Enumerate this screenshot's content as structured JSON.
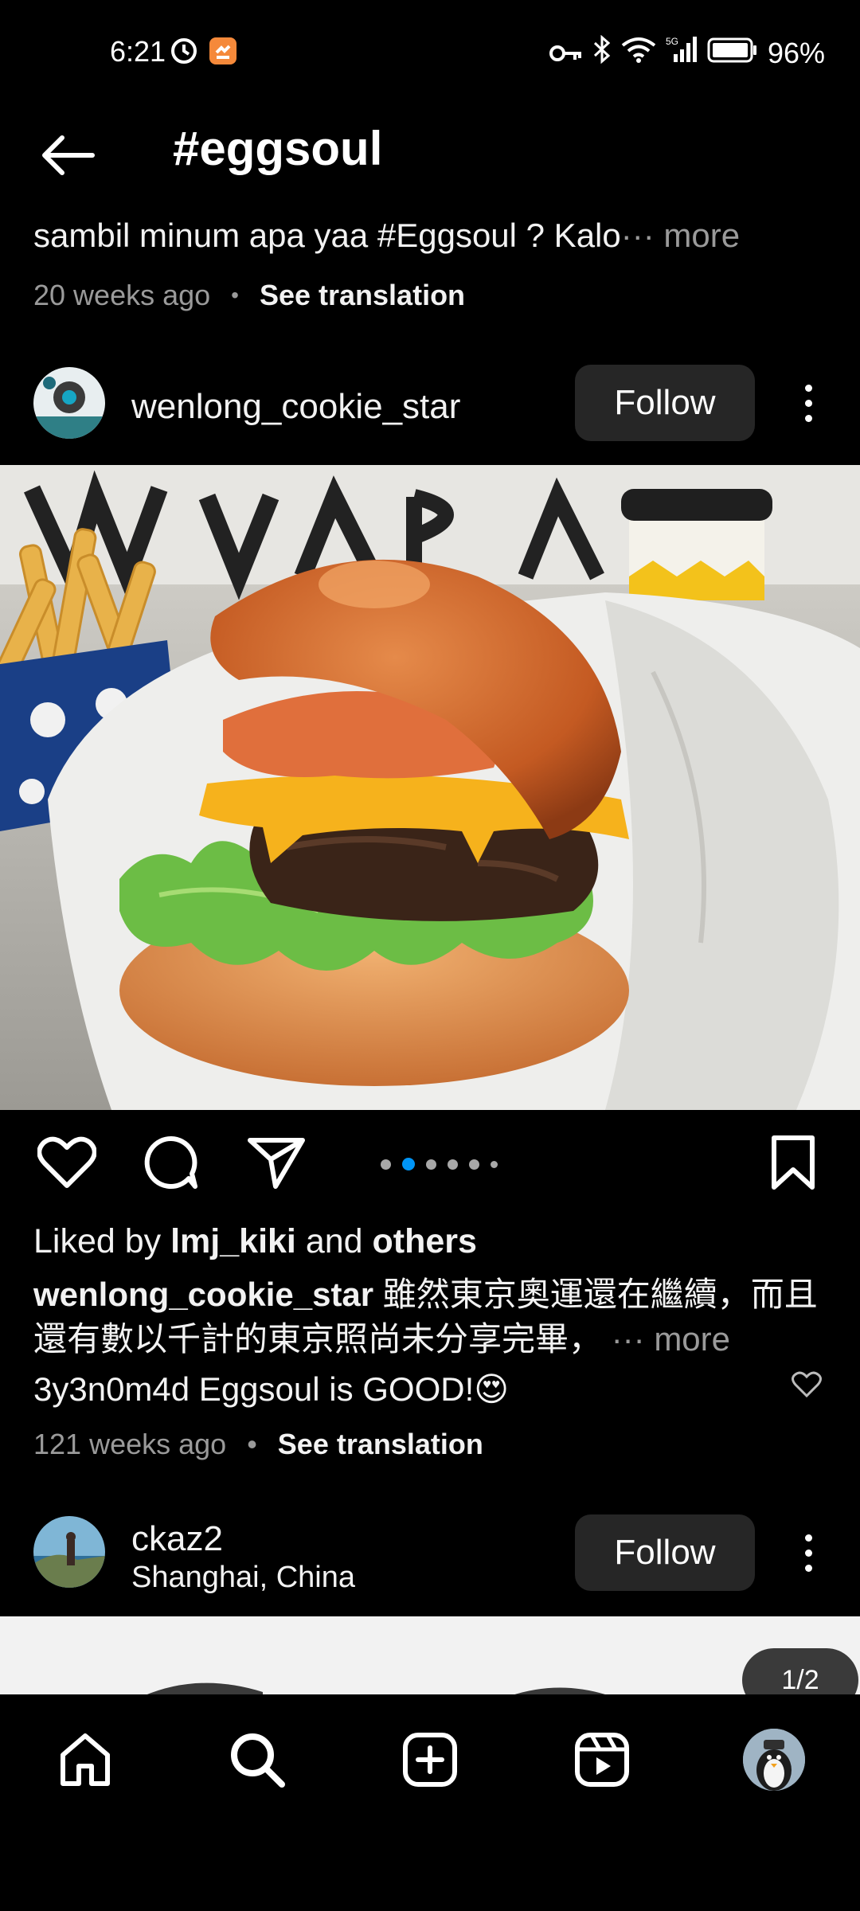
{
  "status_bar": {
    "time": "6:21",
    "battery": "96%",
    "icons": [
      "clock-icon",
      "app-badge-icon",
      "key-icon",
      "bluetooth-icon",
      "wifi-icon",
      "signal-icon",
      "battery-icon"
    ],
    "network": "5G"
  },
  "header": {
    "title": "#eggsoul"
  },
  "prev_post": {
    "caption": "sambil minum apa yaa #Eggsoul ? Kalo",
    "more": "··· more",
    "time": "20 weeks ago",
    "see_translation": "See translation"
  },
  "post1": {
    "username": "wenlong_cookie_star",
    "follow_label": "Follow",
    "liked_prefix": "Liked by ",
    "liked_user": "lmj_kiki",
    "liked_and": " and ",
    "liked_others": "others",
    "caption_user": "wenlong_cookie_star",
    "caption_text_line1": " 雖然東京奧運還在繼續，而且",
    "caption_text_line2": "還有數以千計的東京照尚未分享完畢，",
    "caption_more": "··· more",
    "comment": "3y3n0m4d Eggsoul is GOOD!😍",
    "time": "121 weeks ago",
    "see_translation": "See translation",
    "carousel_active_index": 1,
    "carousel_count": 6
  },
  "post2": {
    "username": "ckaz2",
    "location": "Shanghai, China",
    "follow_label": "Follow",
    "page_indicator": "1/2"
  },
  "bottom_nav": {
    "items": [
      "home-icon",
      "search-icon",
      "create-icon",
      "reels-icon",
      "profile-avatar"
    ]
  },
  "colors": {
    "background": "#000000",
    "follow_button": "#262626",
    "carousel_active": "#0095f6",
    "muted_text": "#9a9a9a"
  }
}
